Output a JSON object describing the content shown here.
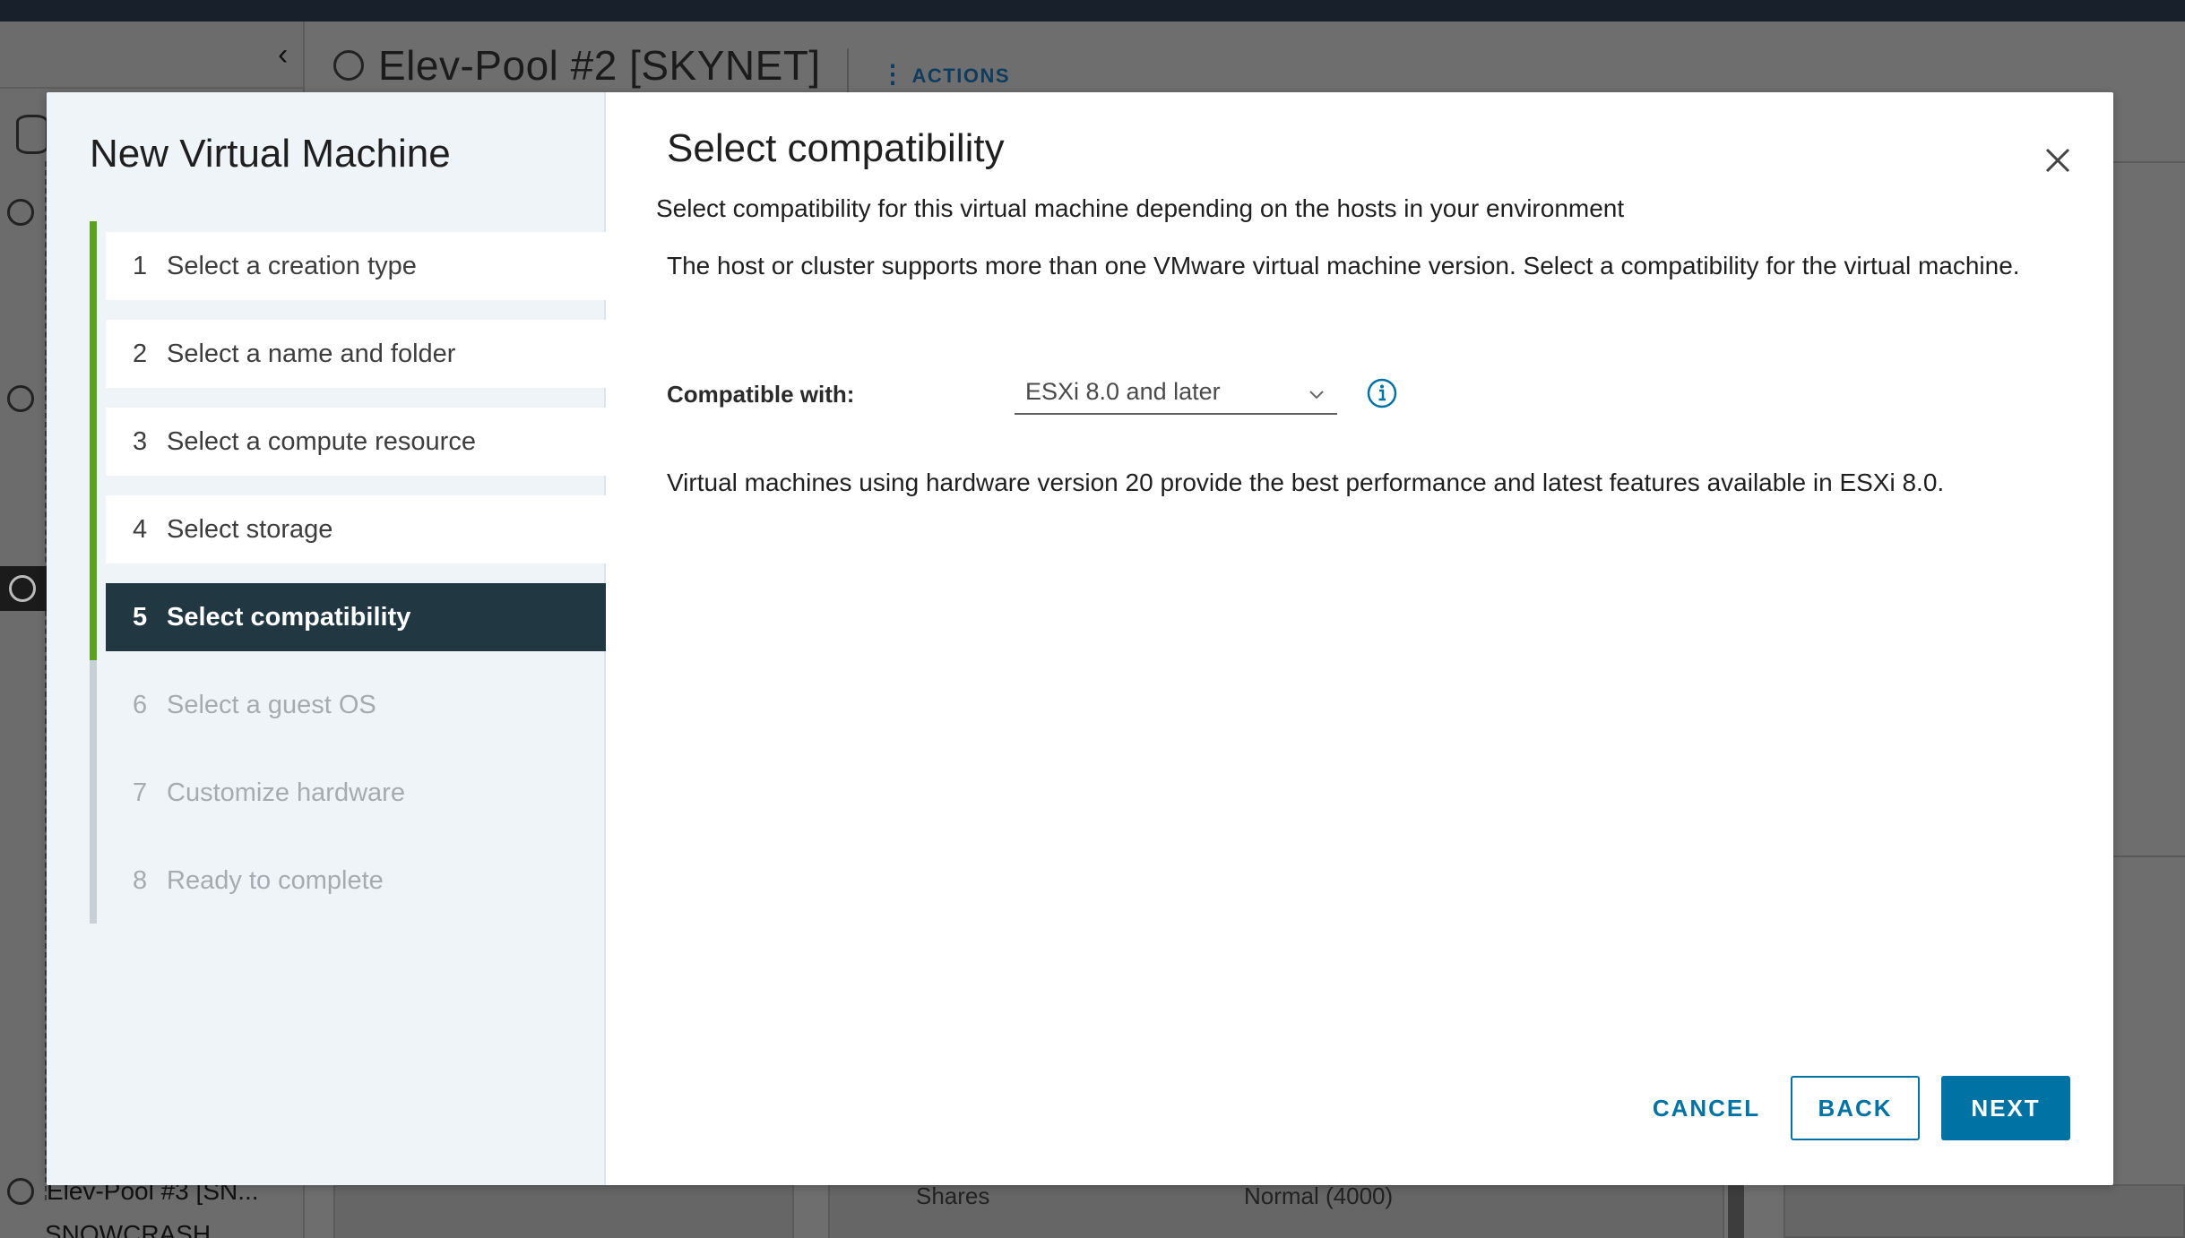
{
  "background": {
    "page_title": "Elev-Pool #2 [SKYNET]",
    "actions_label": "ACTIONS",
    "tree_bottom_item": "Elev-Pool #3 [SN...",
    "tree_bottom_item2": "SNOWCRASH",
    "shares_label": "Shares",
    "shares_value": "Normal (4000)"
  },
  "wizard": {
    "title": "New Virtual Machine",
    "steps": [
      {
        "num": "1",
        "label": "Select a creation type",
        "state": "done"
      },
      {
        "num": "2",
        "label": "Select a name and folder",
        "state": "done"
      },
      {
        "num": "3",
        "label": "Select a compute resource",
        "state": "done"
      },
      {
        "num": "4",
        "label": "Select storage",
        "state": "done"
      },
      {
        "num": "5",
        "label": "Select compatibility",
        "state": "active"
      },
      {
        "num": "6",
        "label": "Select a guest OS",
        "state": "future"
      },
      {
        "num": "7",
        "label": "Customize hardware",
        "state": "future"
      },
      {
        "num": "8",
        "label": "Ready to complete",
        "state": "future"
      }
    ]
  },
  "content": {
    "title": "Select compatibility",
    "subtitle": "Select compatibility for this virtual machine depending on the hosts in your environment",
    "info_text": "The host or cluster supports more than one VMware virtual machine version. Select a compatibility for the virtual machine.",
    "compat_label": "Compatible with:",
    "compat_value": "ESXi 8.0 and later",
    "hw_text": "Virtual machines using hardware version 20 provide the best performance and latest features available in ESXi 8.0."
  },
  "footer": {
    "cancel": "CANCEL",
    "back": "BACK",
    "next": "NEXT"
  },
  "colors": {
    "primary": "#0072a3",
    "active_step": "#213843",
    "done_rail": "#5aa220"
  },
  "icons": [
    "close-icon",
    "info-icon",
    "chevron-down-icon",
    "chevron-left-icon",
    "database-icon",
    "resource-pool-icon"
  ]
}
